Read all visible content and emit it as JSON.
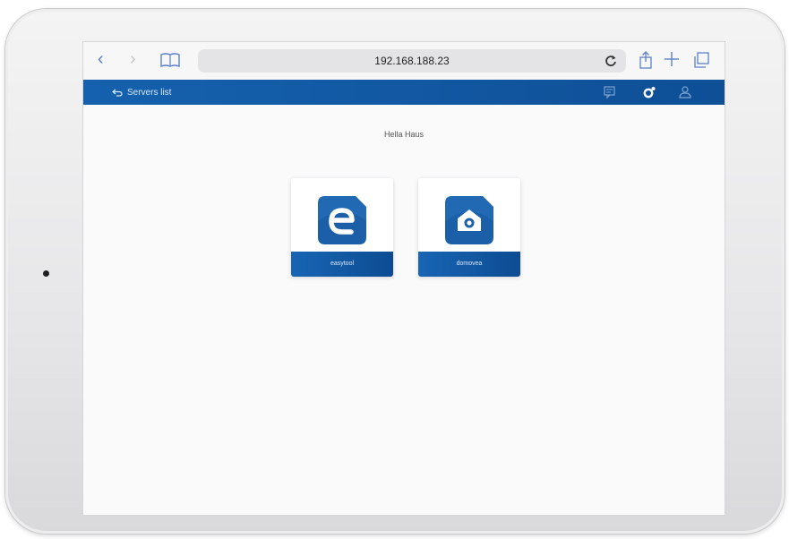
{
  "browser": {
    "url": "192.168.188.23",
    "back_glyph": "‹",
    "forward_glyph": "›"
  },
  "header": {
    "back_label": "Servers list",
    "icons": [
      "chat-icon",
      "settings-icon",
      "user-icon"
    ]
  },
  "page": {
    "title": "Hella Haus"
  },
  "tiles": [
    {
      "label": "easytool",
      "icon": "easytool-logo-icon"
    },
    {
      "label": "domovea",
      "icon": "domovea-logo-icon"
    }
  ],
  "colors": {
    "header_blue": "#1561ae",
    "tile_icon_blue": "#1a5fa8",
    "safari_blue": "#5b80c8"
  }
}
